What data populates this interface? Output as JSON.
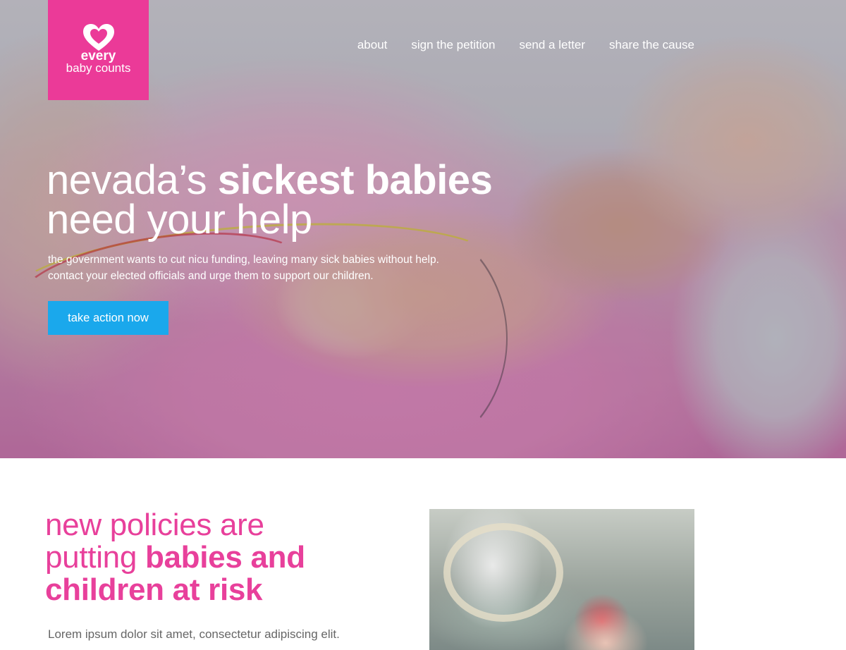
{
  "brand": {
    "line1": "every",
    "line2": "baby counts",
    "color": "#eb3a98"
  },
  "nav": {
    "items": [
      {
        "label": "about"
      },
      {
        "label": "sign the petition"
      },
      {
        "label": "send a letter"
      },
      {
        "label": "share the cause"
      }
    ]
  },
  "hero": {
    "headline_light_1": "nevada’s ",
    "headline_bold_1": "sickest babies",
    "headline_light_2": "need your help",
    "subtext_line1": "the government wants to cut nicu funding, leaving many sick babies without help.",
    "subtext_line2": "contact your elected officials and urge them to support our children.",
    "cta_label": "take action now",
    "cta_color": "#1aa8ec"
  },
  "section2": {
    "heading_light_1": "new policies are",
    "heading_light_2": "putting ",
    "heading_bold_2": "babies and",
    "heading_bold_3": "children at risk",
    "body": "Lorem ipsum dolor sit amet, consectetur adipiscing elit.",
    "heading_color": "#e8409b"
  }
}
